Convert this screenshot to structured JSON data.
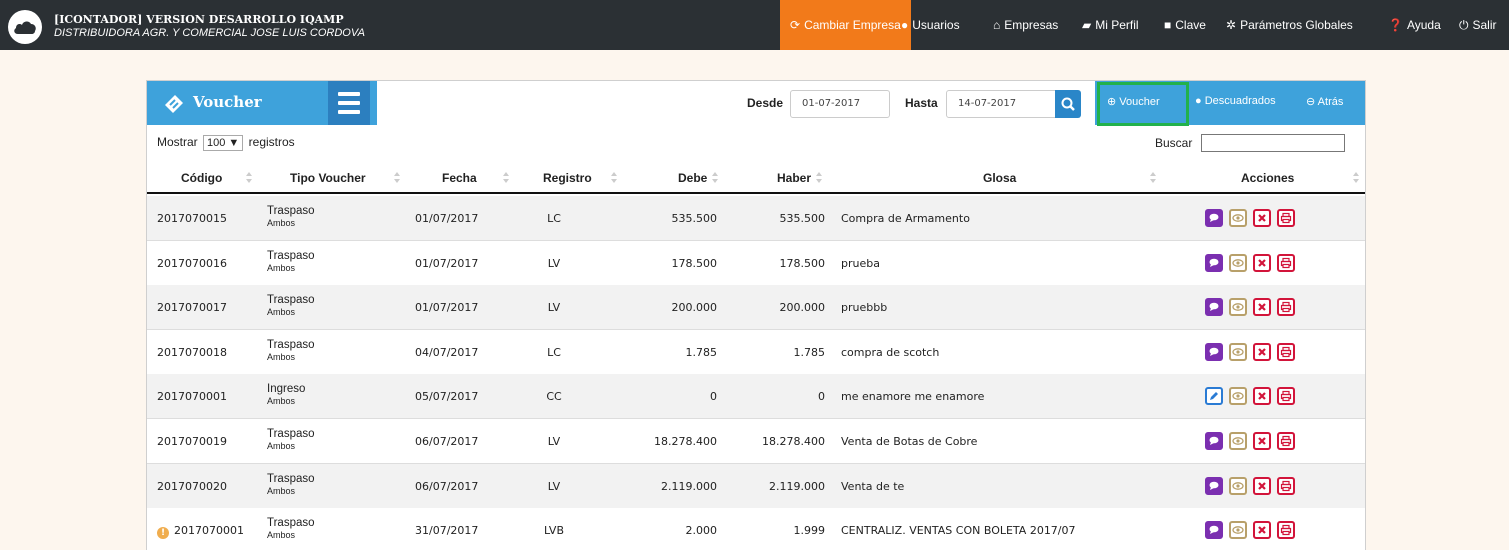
{
  "header": {
    "title": "[ICONTADOR] VERSION DESARROLLO IQAMP",
    "subtitle": "DISTRIBUIDORA AGR. Y COMERCIAL JOSE LUIS CORDOVA"
  },
  "nav": {
    "cambiar_empresa": "Cambiar Empresa",
    "usuarios": "Usuarios",
    "empresas": "Empresas",
    "mi_perfil": "Mi Perfil",
    "clave": "Clave",
    "parametros": "Parámetros Globales",
    "ayuda": "Ayuda",
    "salir": "Salir"
  },
  "panel": {
    "title": "Voucher",
    "desde_label": "Desde",
    "desde_value": "01-07-2017",
    "hasta_label": "Hasta",
    "hasta_value": "14-07-2017",
    "btn_voucher": "Voucher",
    "btn_descuadrados": "Descuadrados",
    "btn_atras": "Atrás"
  },
  "table_controls": {
    "mostrar": "Mostrar",
    "page_size": "100",
    "registros": "registros",
    "buscar": "Buscar"
  },
  "columns": {
    "codigo": "Código",
    "tipo": "Tipo Voucher",
    "fecha": "Fecha",
    "registro": "Registro",
    "debe": "Debe",
    "haber": "Haber",
    "glosa": "Glosa",
    "acciones": "Acciones"
  },
  "rows": [
    {
      "codigo": "2017070015",
      "tipo": "Traspaso",
      "sub": "Ambos",
      "fecha": "01/07/2017",
      "registro": "LC",
      "debe": "535.500",
      "haber": "535.500",
      "glosa": "Compra de Armamento"
    },
    {
      "codigo": "2017070016",
      "tipo": "Traspaso",
      "sub": "Ambos",
      "fecha": "01/07/2017",
      "registro": "LV",
      "debe": "178.500",
      "haber": "178.500",
      "glosa": "prueba"
    },
    {
      "codigo": "2017070017",
      "tipo": "Traspaso",
      "sub": "Ambos",
      "fecha": "01/07/2017",
      "registro": "LV",
      "debe": "200.000",
      "haber": "200.000",
      "glosa": "pruebbb"
    },
    {
      "codigo": "2017070018",
      "tipo": "Traspaso",
      "sub": "Ambos",
      "fecha": "04/07/2017",
      "registro": "LC",
      "debe": "1.785",
      "haber": "1.785",
      "glosa": "compra de scotch"
    },
    {
      "codigo": "2017070001",
      "tipo": "Ingreso",
      "sub": "Ambos",
      "fecha": "05/07/2017",
      "registro": "CC",
      "debe": "0",
      "haber": "0",
      "glosa": "me enamore me enamore"
    },
    {
      "codigo": "2017070019",
      "tipo": "Traspaso",
      "sub": "Ambos",
      "fecha": "06/07/2017",
      "registro": "LV",
      "debe": "18.278.400",
      "haber": "18.278.400",
      "glosa": "Venta de Botas de Cobre"
    },
    {
      "codigo": "2017070020",
      "tipo": "Traspaso",
      "sub": "Ambos",
      "fecha": "06/07/2017",
      "registro": "LV",
      "debe": "2.119.000",
      "haber": "2.119.000",
      "glosa": "Venta de te"
    },
    {
      "codigo": "2017070001",
      "tipo": "Traspaso",
      "sub": "Ambos",
      "fecha": "31/07/2017",
      "registro": "LVB",
      "debe": "2.000",
      "haber": "1.999",
      "glosa": "CENTRALIZ. VENTAS CON BOLETA 2017/07"
    }
  ],
  "colors": {
    "topbar": "#2b3034",
    "accent_orange": "#f27a1a",
    "panel_blue": "#3ea2db",
    "highlight_green": "#22b14c"
  }
}
